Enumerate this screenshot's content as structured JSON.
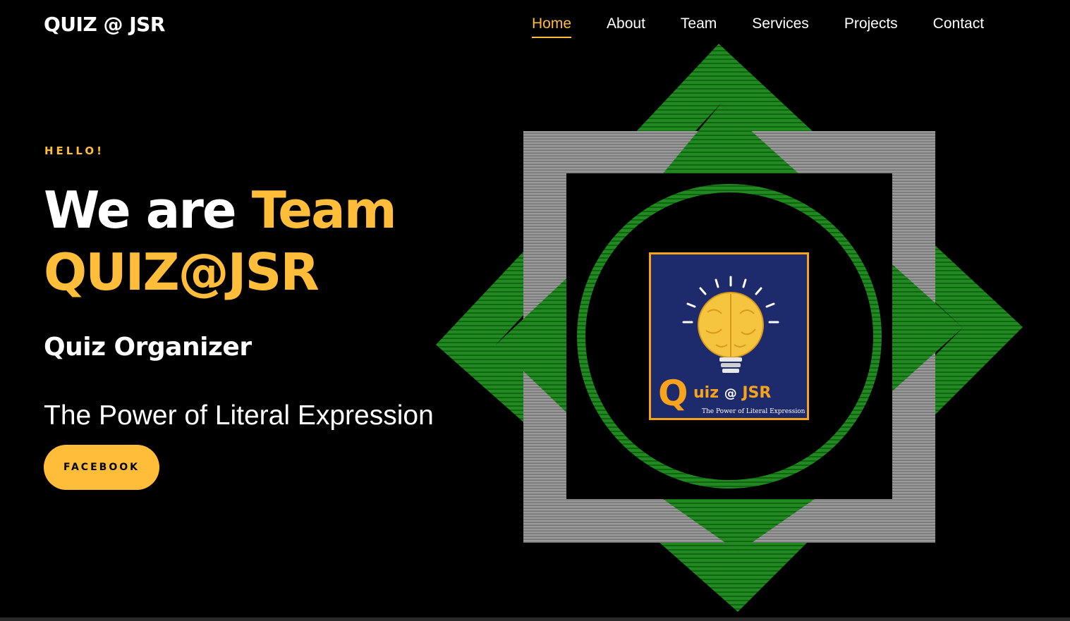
{
  "header": {
    "brand": "QUIZ @ JSR",
    "nav": [
      {
        "label": "Home",
        "active": true
      },
      {
        "label": "About",
        "active": false
      },
      {
        "label": "Team",
        "active": false
      },
      {
        "label": "Services",
        "active": false
      },
      {
        "label": "Projects",
        "active": false
      },
      {
        "label": "Contact",
        "active": false
      }
    ]
  },
  "hero": {
    "eyebrow": "HELLO!",
    "headline_part1": "We are ",
    "headline_part2": "Team",
    "headline_line2": "QUIZ@JSR",
    "role": "Quiz Organizer",
    "tagline": "The Power of Literal Expression",
    "button_label": "FACEBOOK"
  },
  "logo": {
    "q_letter": "Q",
    "word": "uiz",
    "at": "@",
    "jsr": "JSR",
    "subtitle": "The Power of Literal Expression"
  },
  "colors": {
    "accent": "#ffbd39",
    "background": "#000000",
    "emblem_green": "#1f8a1f",
    "logo_navy": "#1d2a6b",
    "logo_orange": "#f7a31c"
  }
}
